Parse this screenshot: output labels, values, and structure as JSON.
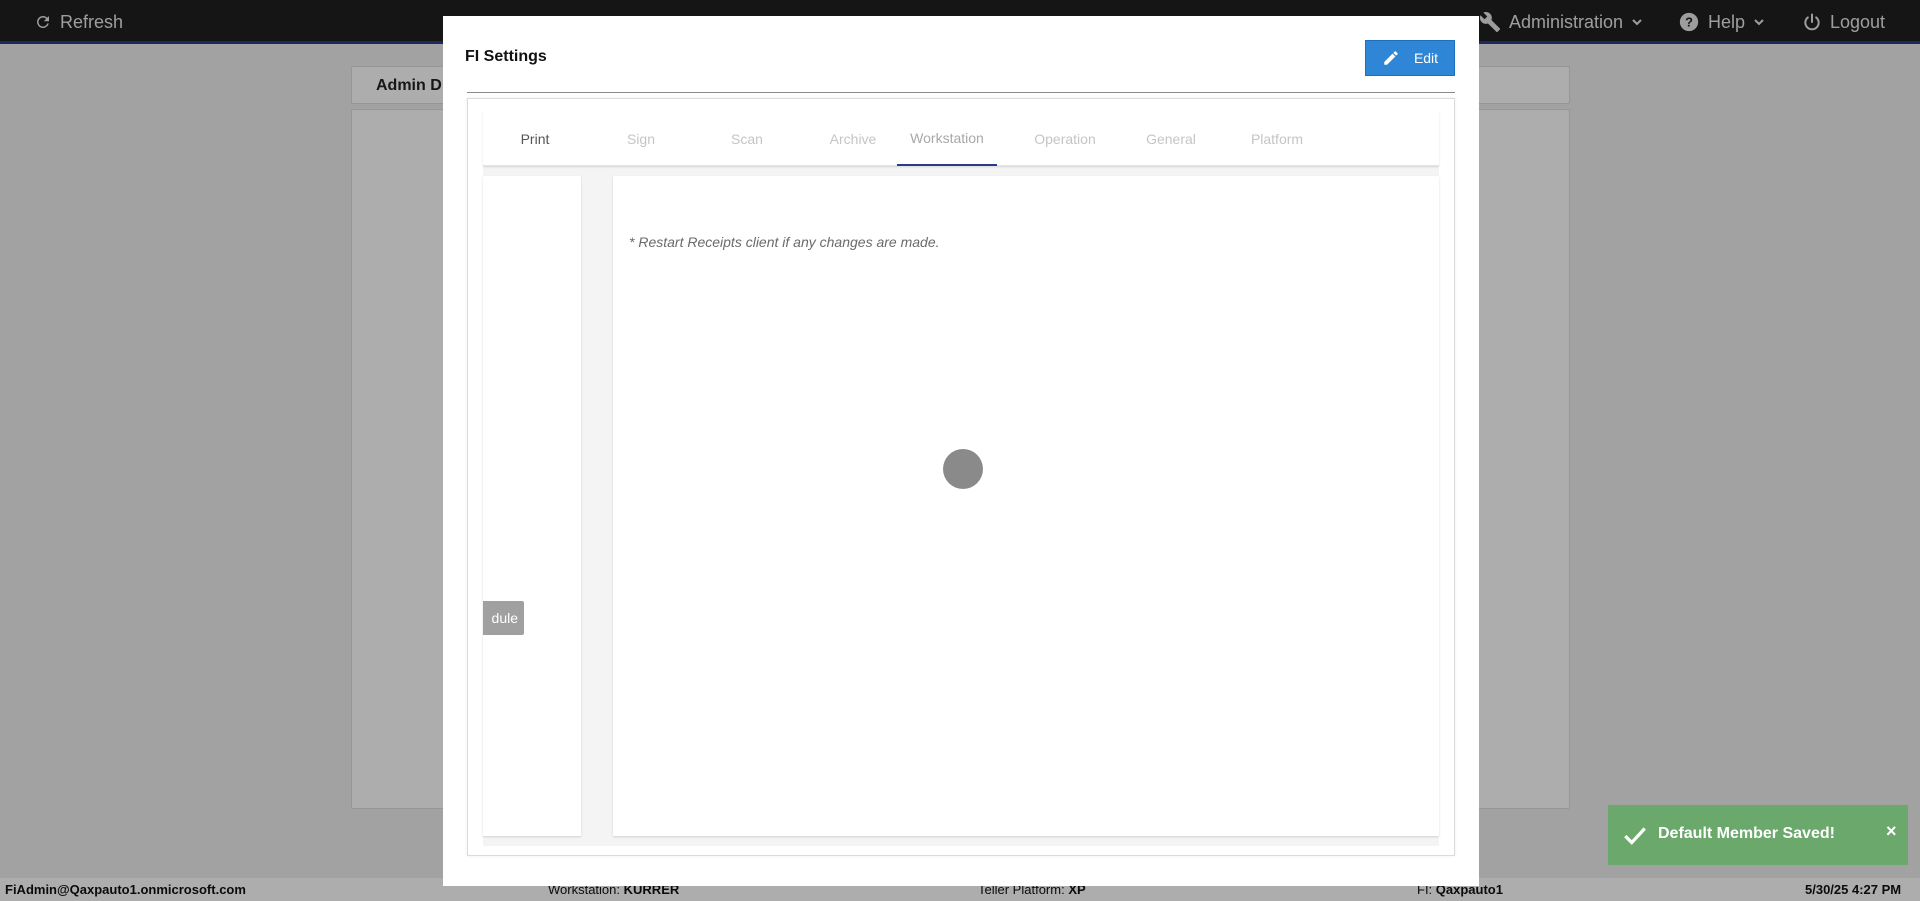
{
  "topbar": {
    "refresh_label": "Refresh",
    "administration_label": "Administration",
    "help_label": "Help",
    "logout_label": "Logout"
  },
  "background": {
    "page_title": "Admin D"
  },
  "modal": {
    "title": "FI Settings",
    "edit_label": "Edit",
    "tabs": [
      "Print",
      "Sign",
      "Scan",
      "Archive",
      "Workstation",
      "Operation",
      "General",
      "Platform"
    ],
    "selected_tab": "Workstation",
    "note": "* Restart Receipts client if any changes are made.",
    "schedule_button_label": "dule"
  },
  "footer": {
    "user": "FiAdmin@Qaxpauto1.onmicrosoft.com",
    "workstation_label": "Workstation:",
    "workstation_value": "KURRER",
    "platform_label": "Teller Platform:",
    "platform_value": "XP",
    "fi_label": "FI:",
    "fi_value": "Qaxpauto1",
    "datetime": "5/30/25 4:27 PM"
  },
  "toast": {
    "message": "Default Member Saved!",
    "close_symbol": "×",
    "color": "#6aa96b"
  },
  "colors": {
    "accent_blue": "#2f86d6",
    "tab_indicator": "#2b3a8f",
    "topbar": "#1f1f1f"
  }
}
